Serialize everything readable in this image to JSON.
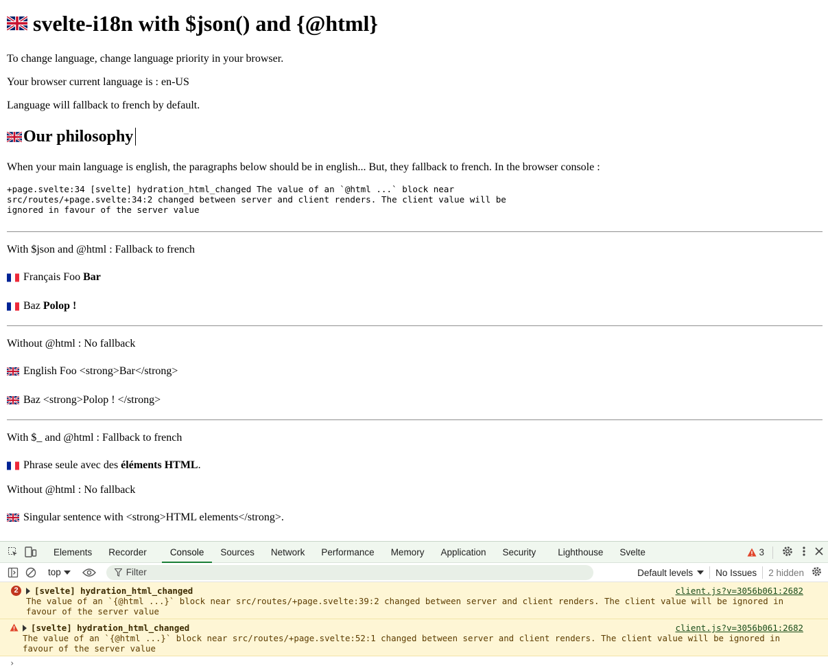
{
  "page": {
    "title": "svelte-i18n with $json() and {@html}",
    "intro_1": "To change language, change language priority in your browser.",
    "intro_2": "Your browser current language is : en-US",
    "intro_3": "Language will fallback to french by default.",
    "section_title": "Our philosophy",
    "explanation": "When your main language is english, the paragraphs below should be in english... But, they fallback to french. In the browser console :",
    "console_log": "+page.svelte:34 [svelte] hydration_html_changed The value of an `@html ...` block near src/routes/+page.svelte:34:2 changed between server and client renders. The client value will be ignored in favour of the server value",
    "block1": {
      "heading": "With $json and @html : Fallback to french",
      "line1_text": "Français Foo ",
      "line1_bold": "Bar",
      "line2_text": "Baz ",
      "line2_bold": "Polop !"
    },
    "block2": {
      "heading": "Without @html : No fallback",
      "line1": "English Foo <strong>Bar</strong>",
      "line2": "Baz <strong>Polop ! </strong>"
    },
    "block3": {
      "heading": "With $_ and @html : Fallback to french",
      "line1_text": "Phrase seule avec des ",
      "line1_bold": "éléments HTML",
      "line1_end": ".",
      "heading2": "Without @html : No fallback",
      "line2": "Singular sentence with <strong>HTML elements</strong>."
    }
  },
  "devtools": {
    "tabs": [
      "Elements",
      "Recorder",
      "Console",
      "Sources",
      "Network",
      "Performance",
      "Memory",
      "Application",
      "Security",
      "Lighthouse",
      "Svelte"
    ],
    "active_tab": "Console",
    "warning_count": "3",
    "context": "top",
    "filter_placeholder": "Filter",
    "levels": "Default levels",
    "issues": "No Issues",
    "hidden": "2 hidden",
    "messages": [
      {
        "count": "2",
        "title": "[svelte] hydration_html_changed",
        "source": "client.js?v=3056b061:2682",
        "body": "The value of an `{@html ...}` block near src/routes/+page.svelte:39:2 changed between server and client renders. The client value will be ignored in favour of the server value"
      },
      {
        "title": "[svelte] hydration_html_changed",
        "source": "client.js?v=3056b061:2682",
        "body": "The value of an `{@html ...}` block near src/routes/+page.svelte:52:1 changed between server and client renders. The client value will be ignored in favour of the server value"
      }
    ],
    "prompt": "›"
  },
  "colors": {
    "warning_bg": "#fef6d5",
    "error_badge": "#c1361f",
    "active_tab": "#1a7f37"
  },
  "icons": [
    "uk-flag-icon",
    "french-flag-icon",
    "inspect-icon",
    "device-toggle-icon",
    "warning-icon",
    "gear-icon",
    "more-icon",
    "close-icon",
    "sidebar-icon",
    "clear-icon",
    "eye-icon",
    "filter-icon"
  ]
}
